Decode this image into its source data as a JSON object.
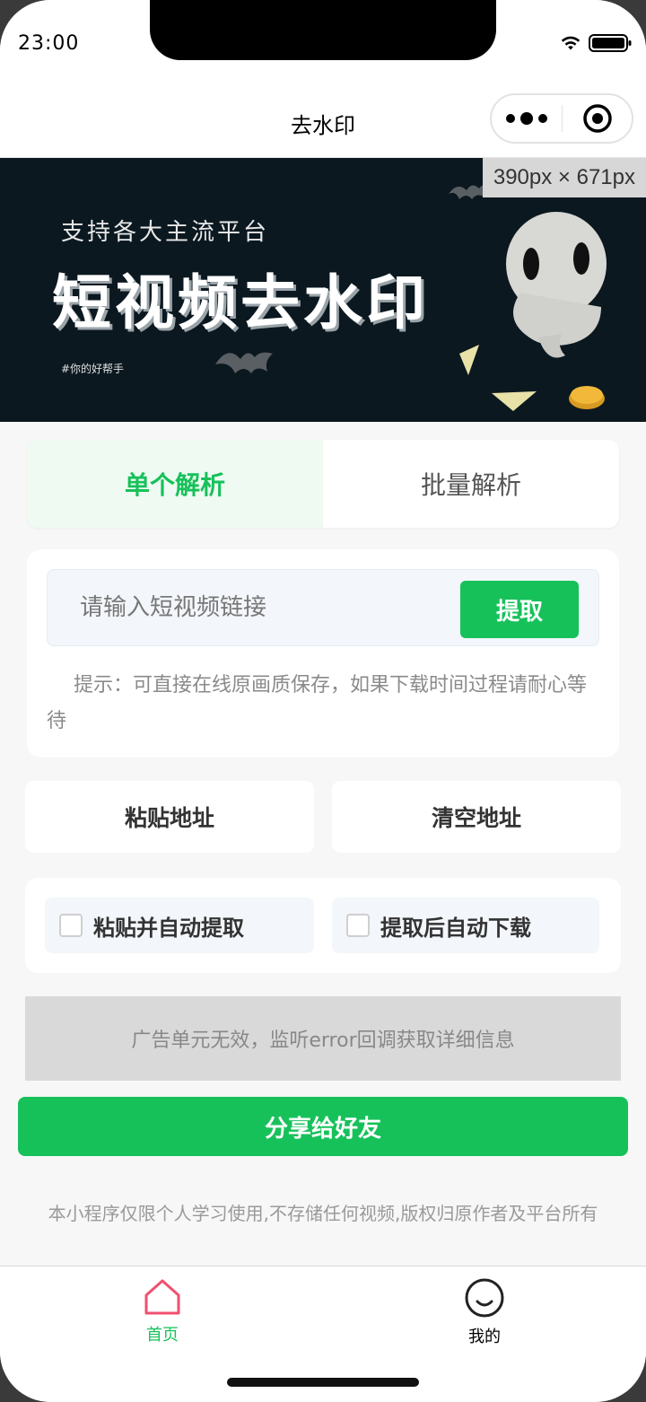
{
  "status_bar": {
    "time": "23:00"
  },
  "navbar": {
    "title": "去水印"
  },
  "banner": {
    "dimension_badge": "390px × 671px",
    "subtitle": "支持各大主流平台",
    "title": "短视频去水印",
    "tag": "#你的好帮手"
  },
  "tabs": [
    {
      "label": "单个解析",
      "active": true
    },
    {
      "label": "批量解析",
      "active": false
    }
  ],
  "input": {
    "placeholder": "请输入短视频链接",
    "value": "",
    "extract_label": "提取"
  },
  "hint": "提示：可直接在线原画质保存，如果下载时间过程请耐心等待",
  "actions": {
    "paste_label": "粘贴地址",
    "clear_label": "清空地址"
  },
  "options": [
    {
      "label": "粘贴并自动提取",
      "checked": false
    },
    {
      "label": "提取后自动下载",
      "checked": false
    }
  ],
  "ad": {
    "message": "广告单元无效，监听error回调获取详细信息"
  },
  "share": {
    "label": "分享给好友"
  },
  "disclaimer": "本小程序仅限个人学习使用,不存储任何视频,版权归原作者及平台所有",
  "tabbar": [
    {
      "label": "首页",
      "icon": "home-icon",
      "active": true
    },
    {
      "label": "我的",
      "icon": "smile-face-icon",
      "active": false
    }
  ],
  "colors": {
    "accent": "#17c15a",
    "home_icon": "#f0506e",
    "banner_bg": "#0b1820"
  }
}
